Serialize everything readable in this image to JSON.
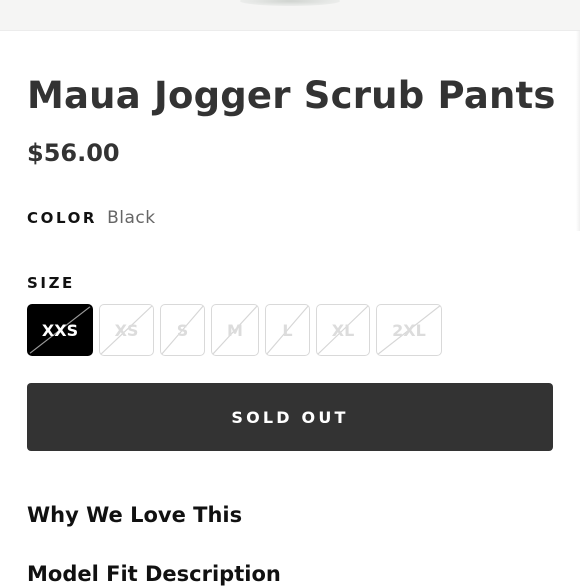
{
  "product": {
    "title": "Maua Jogger Scrub Pants",
    "price": "$56.00"
  },
  "color": {
    "label": "COLOR",
    "value": "Black"
  },
  "size": {
    "label": "SIZE",
    "options": [
      {
        "label": "XXS",
        "selected": true,
        "available": false
      },
      {
        "label": "XS",
        "selected": false,
        "available": false
      },
      {
        "label": "S",
        "selected": false,
        "available": false
      },
      {
        "label": "M",
        "selected": false,
        "available": false
      },
      {
        "label": "L",
        "selected": false,
        "available": false
      },
      {
        "label": "XL",
        "selected": false,
        "available": false
      },
      {
        "label": "2XL",
        "selected": false,
        "available": false
      }
    ]
  },
  "cta": {
    "label": "SOLD OUT"
  },
  "accordions": [
    {
      "label": "Why We Love This"
    },
    {
      "label": "Model Fit Description"
    }
  ],
  "colors": {
    "button_bg": "#333333",
    "selected_swatch_bg": "#000000",
    "text": "#333333"
  }
}
